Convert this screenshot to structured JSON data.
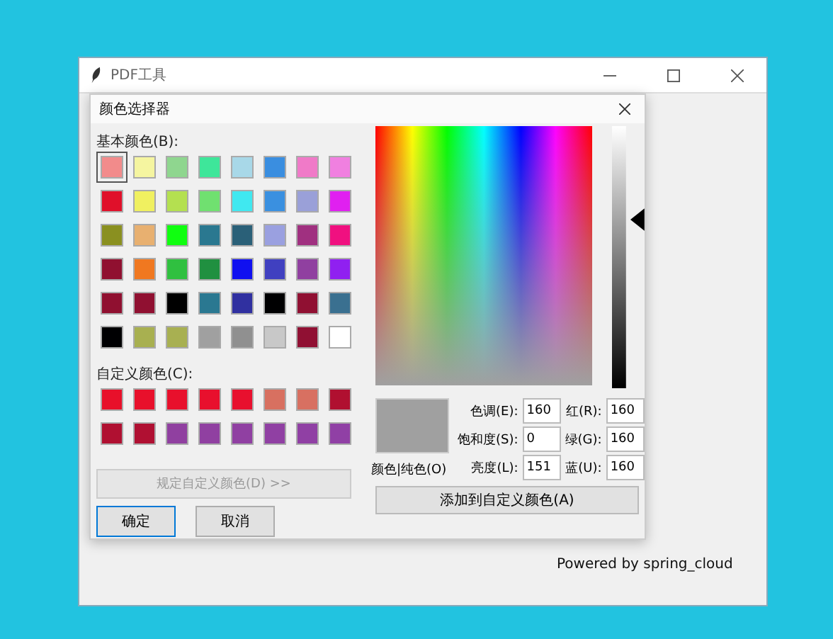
{
  "window": {
    "title": "PDF工具",
    "footer": "Powered by spring_cloud"
  },
  "dialog": {
    "title": "颜色选择器",
    "basic_label": "基本颜色(B):",
    "basic_colors": [
      {
        "color": "#f28b8b",
        "selected": true
      },
      {
        "color": "#f5f5a0",
        "selected": false
      },
      {
        "color": "#8fd68f",
        "selected": false
      },
      {
        "color": "#3ee69a",
        "selected": false
      },
      {
        "color": "#a8d8e8",
        "selected": false
      },
      {
        "color": "#3a8ee0",
        "selected": false
      },
      {
        "color": "#f07ac8",
        "selected": false
      },
      {
        "color": "#f080e0",
        "selected": false
      },
      {
        "color": "#e0102a",
        "selected": false
      },
      {
        "color": "#f0f060",
        "selected": false
      },
      {
        "color": "#b4e050",
        "selected": false
      },
      {
        "color": "#70e070",
        "selected": false
      },
      {
        "color": "#40e8f0",
        "selected": false
      },
      {
        "color": "#3a90e0",
        "selected": false
      },
      {
        "color": "#9aa0d8",
        "selected": false
      },
      {
        "color": "#e020f0",
        "selected": false
      },
      {
        "color": "#8a9020",
        "selected": false
      },
      {
        "color": "#e8b070",
        "selected": false
      },
      {
        "color": "#10ff10",
        "selected": false
      },
      {
        "color": "#2a7890",
        "selected": false
      },
      {
        "color": "#2a6078",
        "selected": false
      },
      {
        "color": "#9aa0e0",
        "selected": false
      },
      {
        "color": "#a03080",
        "selected": false
      },
      {
        "color": "#f01080",
        "selected": false
      },
      {
        "color": "#901030",
        "selected": false
      },
      {
        "color": "#f07820",
        "selected": false
      },
      {
        "color": "#30c040",
        "selected": false
      },
      {
        "color": "#209040",
        "selected": false
      },
      {
        "color": "#1010f0",
        "selected": false
      },
      {
        "color": "#4040c0",
        "selected": false
      },
      {
        "color": "#9040a0",
        "selected": false
      },
      {
        "color": "#9020f0",
        "selected": false
      },
      {
        "color": "#901030",
        "selected": false
      },
      {
        "color": "#901031",
        "selected": false
      },
      {
        "color": "#000000",
        "selected": false
      },
      {
        "color": "#2a7891",
        "selected": false
      },
      {
        "color": "#3030a0",
        "selected": false
      },
      {
        "color": "#000001",
        "selected": false
      },
      {
        "color": "#901032",
        "selected": false
      },
      {
        "color": "#3a7090",
        "selected": false
      },
      {
        "color": "#000002",
        "selected": false
      },
      {
        "color": "#a8b050",
        "selected": false
      },
      {
        "color": "#a8b051",
        "selected": false
      },
      {
        "color": "#a0a0a0",
        "selected": false
      },
      {
        "color": "#909090",
        "selected": false
      },
      {
        "color": "#c8c8c8",
        "selected": false
      },
      {
        "color": "#901033",
        "selected": false
      },
      {
        "color": "#ffffff",
        "selected": false
      }
    ],
    "custom_label": "自定义颜色(C):",
    "custom_colors": [
      {
        "color": "#e8102a"
      },
      {
        "color": "#e8102b"
      },
      {
        "color": "#e8102c"
      },
      {
        "color": "#e8102d"
      },
      {
        "color": "#e8102e"
      },
      {
        "color": "#d87060"
      },
      {
        "color": "#d87061"
      },
      {
        "color": "#b01030"
      },
      {
        "color": "#b01031"
      },
      {
        "color": "#b01032"
      },
      {
        "color": "#9040a0"
      },
      {
        "color": "#9040a1"
      },
      {
        "color": "#9040a2"
      },
      {
        "color": "#9040a3"
      },
      {
        "color": "#9040a4"
      },
      {
        "color": "#9040a5"
      }
    ],
    "define_button": {
      "label": "规定自定义颜色(D) >>",
      "disabled": true
    },
    "ok_button": "确定",
    "cancel_button": "取消",
    "preview_label": "颜色|纯色(O)",
    "fields": [
      {
        "label": "色调(E):",
        "value": "160"
      },
      {
        "label": "红(R):",
        "value": "160"
      },
      {
        "label": "饱和度(S):",
        "value": "0"
      },
      {
        "label": "绿(G):",
        "value": "160"
      },
      {
        "label": "亮度(L):",
        "value": "151"
      },
      {
        "label": "蓝(U):",
        "value": "160"
      }
    ],
    "add_button": "添加到自定义颜色(A)"
  }
}
